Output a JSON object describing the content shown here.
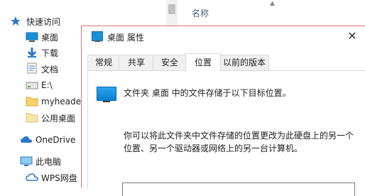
{
  "explorer": {
    "column_header": "名称",
    "nav": [
      {
        "label": "快速访问",
        "icon": "star-icon"
      },
      {
        "label": "桌面",
        "icon": "desktop-icon"
      },
      {
        "label": "下载",
        "icon": "download-icon"
      },
      {
        "label": "文档",
        "icon": "document-icon"
      },
      {
        "label": "E:\\",
        "icon": "drive-icon"
      },
      {
        "label": "myheader",
        "icon": "folder-icon"
      },
      {
        "label": "公用桌面",
        "icon": "folder-icon"
      },
      {
        "label": "OneDrive",
        "icon": "cloud-icon"
      },
      {
        "label": "此电脑",
        "icon": "computer-icon"
      },
      {
        "label": "WPS网盘",
        "icon": "wps-cloud-icon"
      }
    ]
  },
  "dialog": {
    "title": "桌面 属性",
    "close_glyph": "✕",
    "tabs": [
      {
        "label": "常规"
      },
      {
        "label": "共享"
      },
      {
        "label": "安全"
      },
      {
        "label": "位置",
        "active": true
      },
      {
        "label": "以前的版本"
      }
    ],
    "location_description": "文件夹 桌面 中的文件存储于以下目标位置。",
    "help_text": "你可以将此文件夹中文件存储的位置更改为此硬盘上的另一个位置、另一个驱动器或网络上的另一台计算机。",
    "path_value": ""
  }
}
